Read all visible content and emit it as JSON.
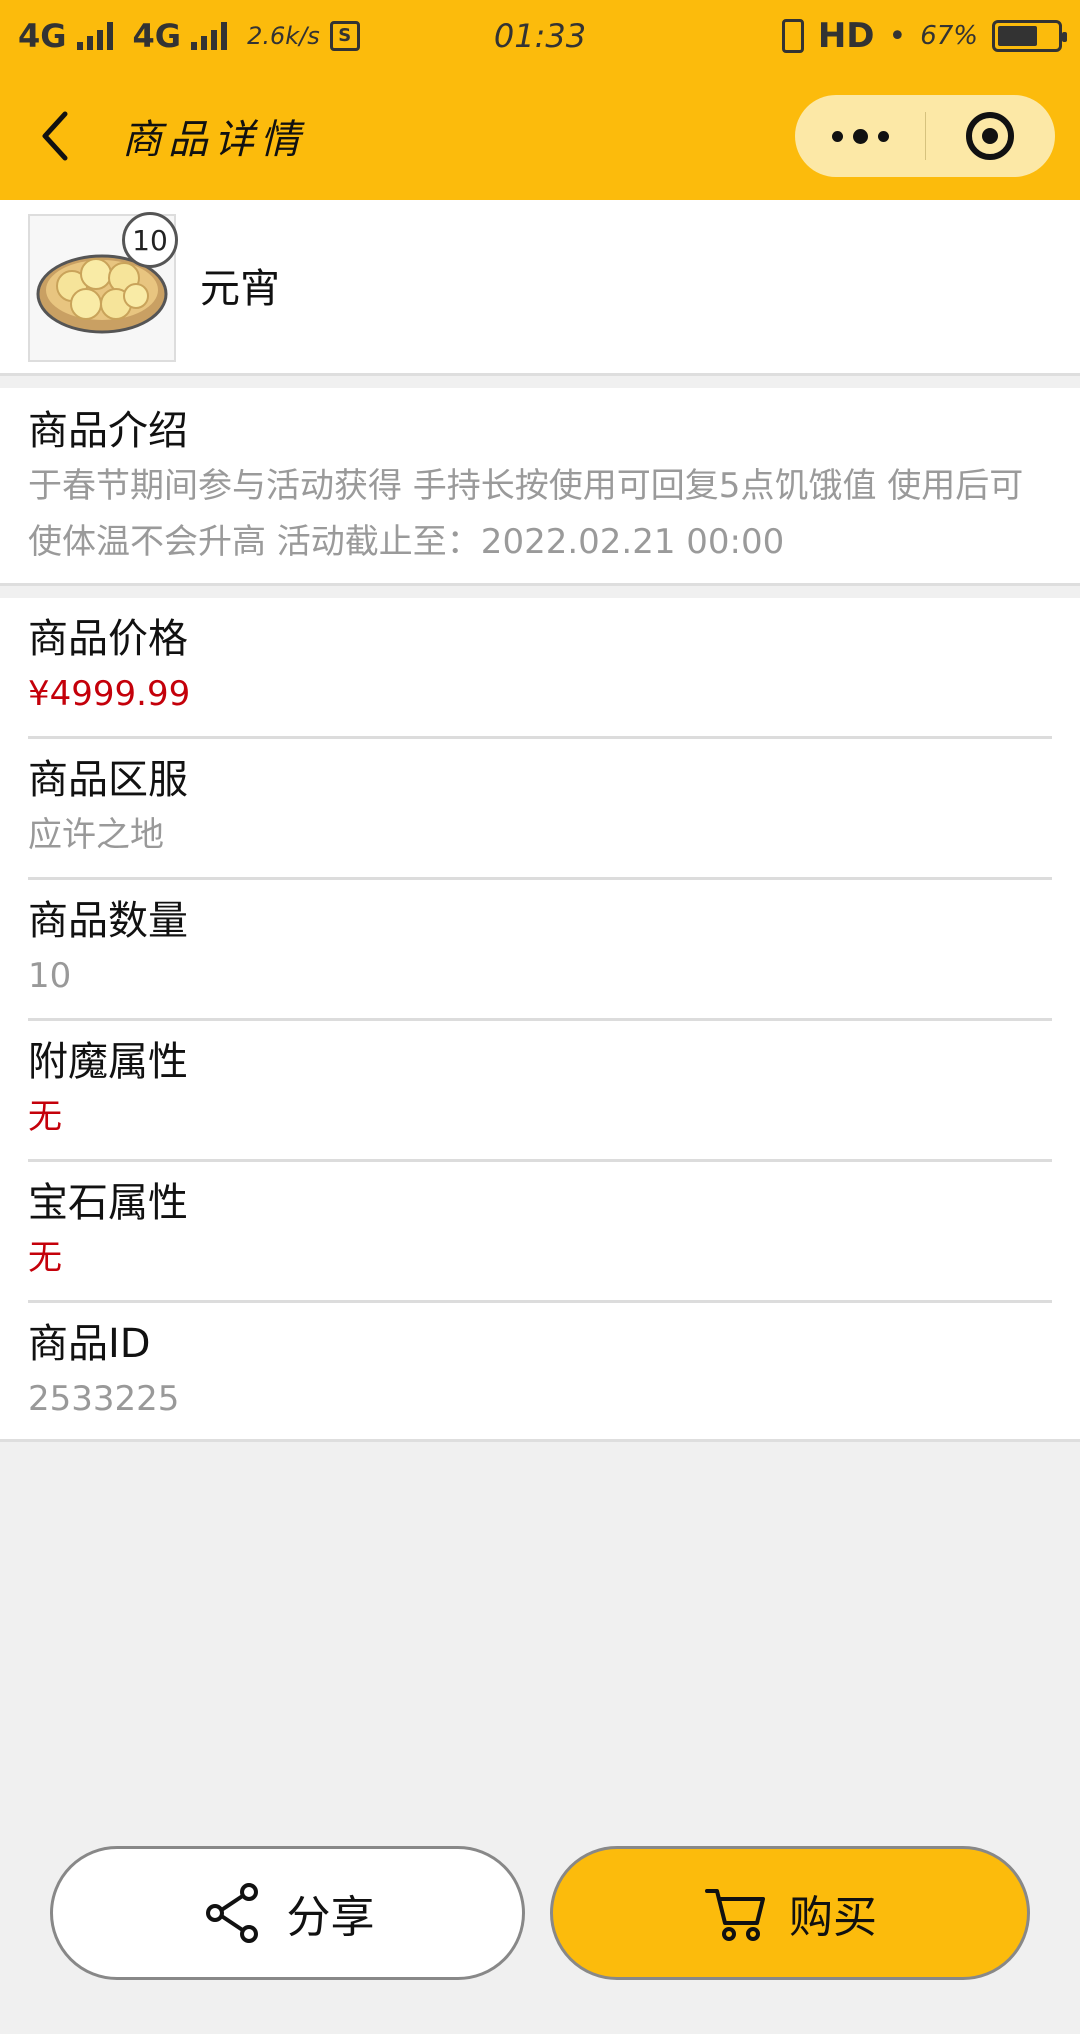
{
  "status_bar": {
    "network1": "4G",
    "network2": "4G",
    "speed": "2.6k/s",
    "sim_icon_label": "S",
    "time": "01:33",
    "hd": "HD",
    "battery_percent": "67%",
    "battery_level": 0.67
  },
  "nav": {
    "title": "商品详情"
  },
  "item": {
    "name": "元宵",
    "quantity_badge": "10",
    "image_icon": "yuanxiao-icon"
  },
  "intro": {
    "label": "商品介绍",
    "text": "于春节期间参与活动获得 手持长按使用可回复5点饥饿值 使用后可使体温不会升高 活动截止至：2022.02.21 00:00"
  },
  "details": [
    {
      "label": "商品价格",
      "value": "¥4999.99",
      "style": "red"
    },
    {
      "label": "商品区服",
      "value": "应许之地",
      "style": "gray"
    },
    {
      "label": "商品数量",
      "value": "10",
      "style": "gray"
    },
    {
      "label": "附魔属性",
      "value": "无",
      "style": "red"
    },
    {
      "label": "宝石属性",
      "value": "无",
      "style": "red"
    },
    {
      "label": "商品ID",
      "value": "2533225",
      "style": "gray"
    }
  ],
  "actions": {
    "share_label": "分享",
    "buy_label": "购买"
  },
  "colors": {
    "accent": "#fcbb0c",
    "price_red": "#c4000a",
    "muted_text": "#999999"
  }
}
